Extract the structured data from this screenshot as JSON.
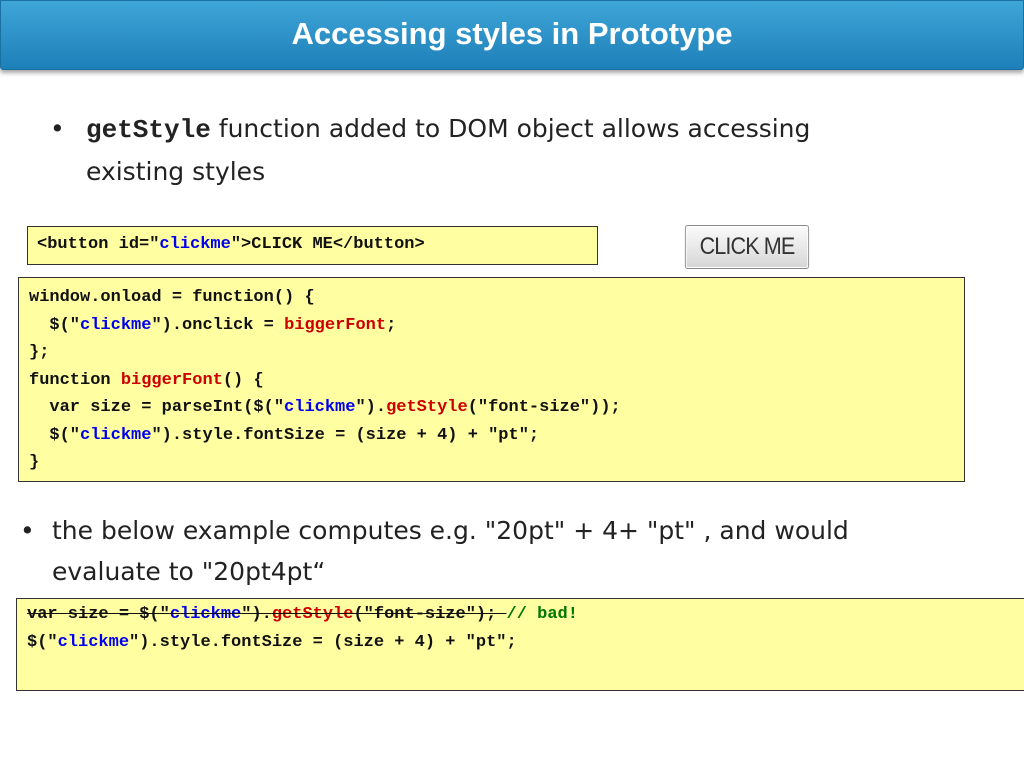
{
  "title": "Accessing styles in Prototype",
  "bullet1": {
    "code": "getStyle",
    "text1": " function added to DOM object allows accessing",
    "text2": "existing styles"
  },
  "code_button_html": {
    "p1": "<button id=\"",
    "p2": "clickme",
    "p3": "\">CLICK ME</button>"
  },
  "click_me_button": "CLICK ME",
  "code_main": {
    "l1": "window.onload = function() {",
    "l2a": "  $(\"",
    "l2b": "clickme",
    "l2c": "\").onclick = ",
    "l2d": "biggerFont",
    "l2e": ";",
    "l3": "};",
    "l4a": "function ",
    "l4b": "biggerFont",
    "l4c": "() {",
    "l5a": "  var size = parseInt($(\"",
    "l5b": "clickme",
    "l5c": "\").",
    "l5d": "getStyle",
    "l5e": "(\"font-size\"));",
    "l6a": "  $(\"",
    "l6b": "clickme",
    "l6c": "\").style.fontSize = (size + 4) + \"pt\";",
    "l7": "}"
  },
  "bullet2": {
    "text1": "the below example computes e.g. \"20pt\" + 4+ \"pt\" , and would",
    "text2": "evaluate to \"20pt4pt“"
  },
  "code_bad": {
    "l1a": "var size = $(\"",
    "l1b": "clickme",
    "l1c": "\").",
    "l1d": "getStyle",
    "l1e": "(\"font-size\"); ",
    "l1f": "// bad!",
    "l2a": "$(\"",
    "l2b": "clickme",
    "l2c": "\").style.fontSize = (size + 4) + \"pt\";"
  }
}
